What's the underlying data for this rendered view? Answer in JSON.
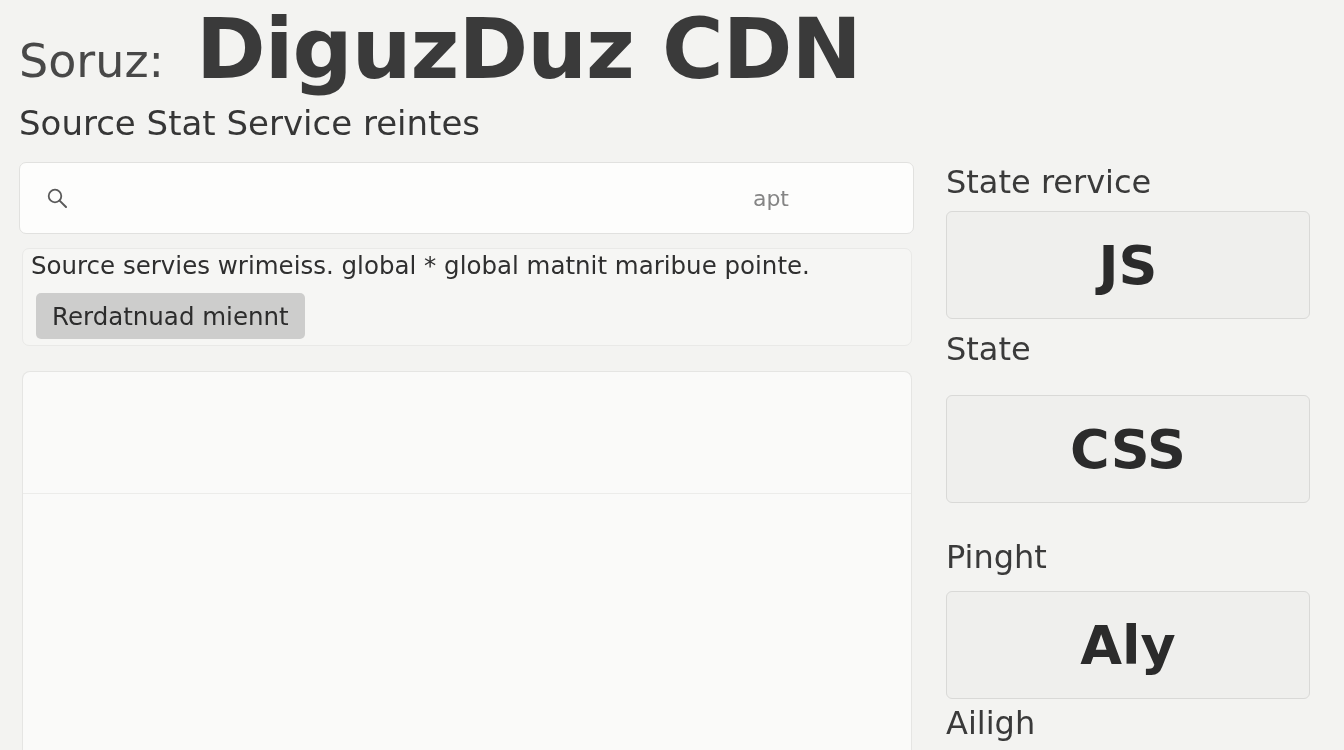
{
  "header": {
    "prefix": "Soruz:",
    "title": "DiguzDuz CDN"
  },
  "main": {
    "heading": "Source Stat Service reintes",
    "search": {
      "placeholder": "apt"
    },
    "notice": {
      "text": "Source servies wrimeiss. global * global matnit maribue pointe.",
      "button": "Rerdatnuad miennt"
    }
  },
  "sidebar": {
    "items": [
      {
        "kind": "label",
        "text": "State rervice"
      },
      {
        "kind": "tile",
        "text": "JS"
      },
      {
        "kind": "label",
        "text": "State"
      },
      {
        "kind": "tile",
        "text": "CSS"
      },
      {
        "kind": "label",
        "text": "Pinght"
      },
      {
        "kind": "tile",
        "text": "Aly"
      },
      {
        "kind": "label",
        "text": "Ailigh"
      }
    ]
  }
}
